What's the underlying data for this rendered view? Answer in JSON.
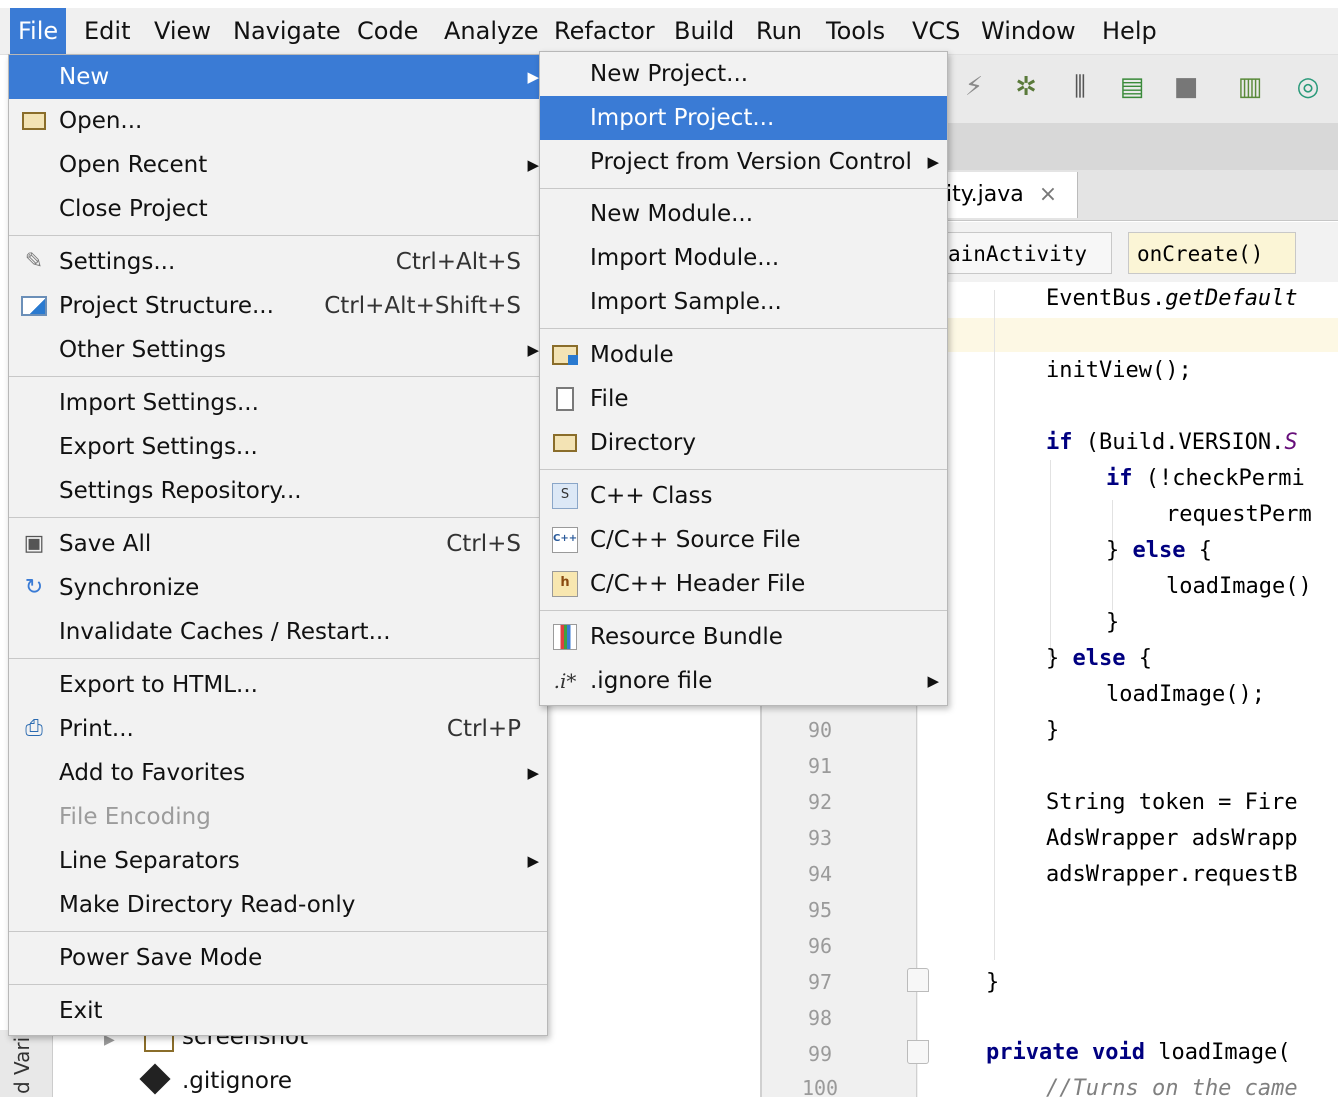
{
  "menubar": {
    "items": [
      "File",
      "Edit",
      "View",
      "Navigate",
      "Code",
      "Analyze",
      "Refactor",
      "Build",
      "Run",
      "Tools",
      "VCS",
      "Window",
      "Help"
    ]
  },
  "file_menu": {
    "items": [
      {
        "label": "New",
        "arrow": true,
        "selected": true
      },
      {
        "label": "Open...",
        "icon": "folder-icon"
      },
      {
        "label": "Open Recent",
        "arrow": true
      },
      {
        "label": "Close Project"
      },
      {
        "label": "Settings...",
        "shortcut": "Ctrl+Alt+S",
        "icon": "wrench-icon"
      },
      {
        "label": "Project Structure...",
        "shortcut": "Ctrl+Alt+Shift+S",
        "icon": "project-structure-icon"
      },
      {
        "label": "Other Settings",
        "arrow": true
      },
      {
        "label": "Import Settings..."
      },
      {
        "label": "Export Settings..."
      },
      {
        "label": "Settings Repository..."
      },
      {
        "label": "Save All",
        "shortcut": "Ctrl+S",
        "icon": "save-icon"
      },
      {
        "label": "Synchronize",
        "icon": "sync-icon"
      },
      {
        "label": "Invalidate Caches / Restart..."
      },
      {
        "label": "Export to HTML..."
      },
      {
        "label": "Print...",
        "shortcut": "Ctrl+P",
        "icon": "printer-icon"
      },
      {
        "label": "Add to Favorites",
        "arrow": true
      },
      {
        "label": "File Encoding",
        "disabled": true
      },
      {
        "label": "Line Separators",
        "arrow": true
      },
      {
        "label": "Make Directory Read-only"
      },
      {
        "label": "Power Save Mode"
      },
      {
        "label": "Exit"
      }
    ]
  },
  "new_menu": {
    "items": [
      {
        "label": "New Project..."
      },
      {
        "label": "Import Project...",
        "selected": true
      },
      {
        "label": "Project from Version Control",
        "arrow": true
      },
      {
        "label": "New Module..."
      },
      {
        "label": "Import Module..."
      },
      {
        "label": "Import Sample..."
      },
      {
        "label": "Module",
        "icon": "module-icon"
      },
      {
        "label": "File",
        "icon": "file-icon"
      },
      {
        "label": "Directory",
        "icon": "folder-icon"
      },
      {
        "label": "C++ Class",
        "icon": "cpp-class-icon",
        "icon_text": "S"
      },
      {
        "label": "C/C++ Source File",
        "icon": "cpp-source-icon",
        "icon_text": "C++"
      },
      {
        "label": "C/C++ Header File",
        "icon": "cpp-header-icon",
        "icon_text": "h"
      },
      {
        "label": "Resource Bundle",
        "icon": "resource-bundle-icon"
      },
      {
        "label": ".ignore file",
        "icon": "ignore-file-icon",
        "icon_text": ".i*",
        "arrow": true
      }
    ]
  },
  "editor": {
    "tab_label": "ity.java",
    "tab_close": "×",
    "crumb_class": "ainActivity",
    "crumb_method": "onCreate()",
    "line_numbers": [
      "90",
      "91",
      "92",
      "93",
      "94",
      "95",
      "96",
      "97",
      "98",
      "99",
      "100"
    ],
    "code": {
      "l1_a": "EventBus.",
      "l1_b": "getDefault",
      "l2": "initView();",
      "l3_kw": "if",
      "l3_a": " (Build.VERSION.",
      "l3_b": "S",
      "l4_kw": "if",
      "l4_a": " (!checkPermi",
      "l5": "requestPerm",
      "l6_a": "} ",
      "l6_kw": "else",
      "l6_b": " {",
      "l7": "loadImage()",
      "l8": "}",
      "l9_a": "} ",
      "l9_kw": "else",
      "l9_b": " {",
      "l10": "loadImage();",
      "l11": "}",
      "l12": "String token = Fire",
      "l13": "AdsWrapper adsWrapp",
      "l14": "adsWrapper.requestB",
      "l15": "}",
      "l16_kw": "private void",
      "l16_a": " loadImage(",
      "l17": "//Turns on the came"
    }
  },
  "project_panel": {
    "side_label": "d Vari",
    "items": [
      {
        "label": "screenshot",
        "icon": "folder-icon"
      },
      {
        "label": ".gitignore",
        "icon": "git-icon"
      }
    ]
  },
  "colors": {
    "selection": "#3a7bd5",
    "menu_bg": "#f2f2f2",
    "keyword": "#000080"
  }
}
